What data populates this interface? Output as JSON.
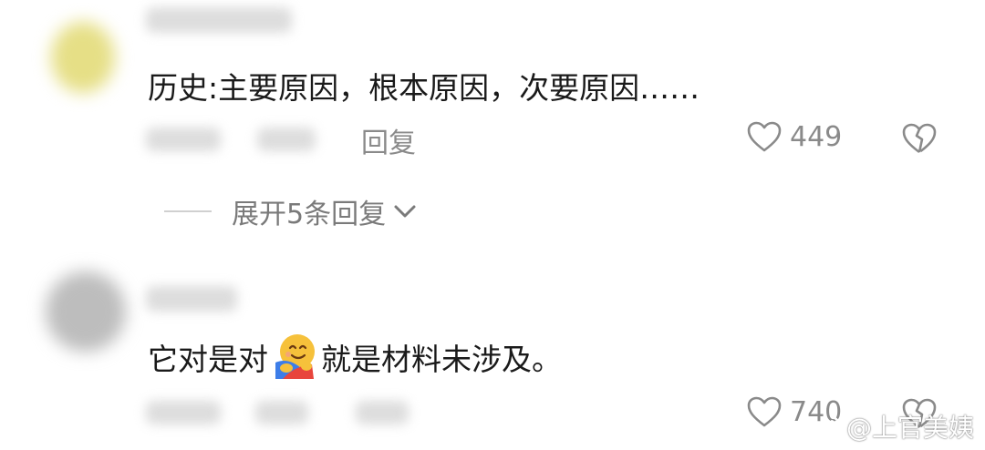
{
  "comments": [
    {
      "text": "历史:主要原因，根本原因，次要原因……",
      "reply_label": "回复",
      "like_count": "449",
      "expand_label": "展开5条回复"
    },
    {
      "text_before_emoji": "它对是对",
      "emoji": "hugging-face-emoji",
      "text_after_emoji": "就是材料未涉及。",
      "like_count": "740"
    }
  ],
  "watermark": "@上官美姨",
  "colors": {
    "muted": "#8a8a8a",
    "text": "#1a1a1a",
    "background": "#ffffff"
  }
}
